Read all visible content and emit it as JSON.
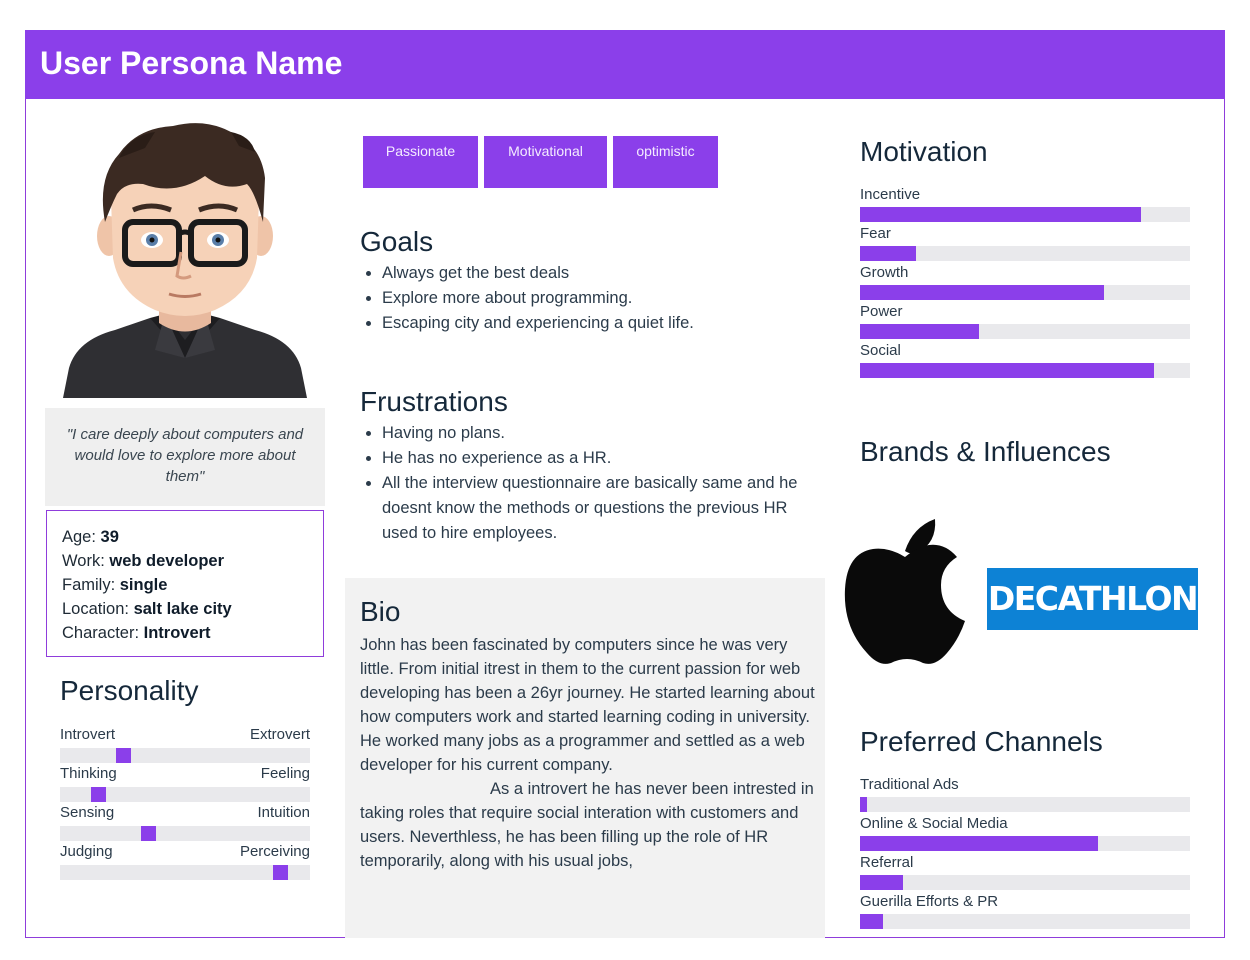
{
  "title": "User Persona Name",
  "quote": "\"I care deeply about computers and would love to explore more about them\"",
  "info": [
    {
      "label": "Age: ",
      "value": "39"
    },
    {
      "label": "Work: ",
      "value": "web developer"
    },
    {
      "label": "Family: ",
      "value": "single"
    },
    {
      "label": "Location: ",
      "value": "salt lake city"
    },
    {
      "label": "Character: ",
      "value": "Introvert"
    }
  ],
  "personality": {
    "heading": "Personality",
    "traits": [
      {
        "left": "Introvert",
        "right": "Extrovert",
        "position": 0.25
      },
      {
        "left": "Thinking",
        "right": "Feeling",
        "position": 0.15
      },
      {
        "left": "Sensing",
        "right": "Intuition",
        "position": 0.35
      },
      {
        "left": "Judging",
        "right": "Perceiving",
        "position": 0.88
      }
    ]
  },
  "tags": [
    "Passionate",
    "Motivational",
    "optimistic"
  ],
  "goals": {
    "heading": "Goals",
    "items": [
      "Always get the best deals",
      "Explore more about programming.",
      "Escaping city and experiencing a quiet life."
    ]
  },
  "frustrations": {
    "heading": "Frustrations",
    "items": [
      "Having no plans.",
      "He has no experience as a HR.",
      "All the interview questionnaire are basically same and he doesnt know the methods or questions the previous HR used to hire employees."
    ]
  },
  "bio": {
    "heading": "Bio",
    "para1": "John has been fascinated by computers since he was very little. From initial itrest in them to the current passion for web developing has been a 26yr journey. He started learning about how computers work and started learning coding in university. He worked many jobs as a programmer and settled as a web developer for his current company.",
    "para2": "As a introvert he has never been intrested in taking roles that require social interation with customers and users. Neverthless, he has been filling up the role of HR temporarily, along with his usual jobs,"
  },
  "motivation": {
    "heading": "Motivation",
    "items": [
      {
        "label": "Incentive",
        "value": 0.85
      },
      {
        "label": "Fear",
        "value": 0.17
      },
      {
        "label": "Growth",
        "value": 0.74
      },
      {
        "label": "Power",
        "value": 0.36
      },
      {
        "label": "Social",
        "value": 0.89
      }
    ]
  },
  "brands": {
    "heading": "Brands & Influences",
    "logos": [
      "apple-logo",
      "decathlon-logo"
    ],
    "decathlon_text": "DECATHLON"
  },
  "channels": {
    "heading": "Preferred Channels",
    "items": [
      {
        "label": "Traditional Ads",
        "value": 0.02
      },
      {
        "label": "Online & Social Media",
        "value": 0.72
      },
      {
        "label": "Referral",
        "value": 0.13
      },
      {
        "label": "Guerilla Efforts & PR",
        "value": 0.07
      }
    ]
  },
  "colors": {
    "accent": "#8b3fea",
    "track": "#e9e9ec",
    "panel": "#f2f2f2",
    "brand_blue": "#0d82d5"
  }
}
